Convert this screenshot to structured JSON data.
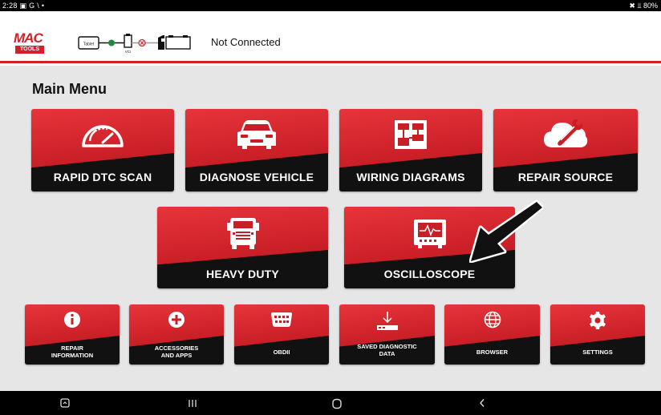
{
  "status_bar": {
    "time": "2:28",
    "left_icons": "▣ G \\ •",
    "right": "✖ ⫫ 80%"
  },
  "header": {
    "logo_top": "MAC",
    "logo_bottom": "TOOLS",
    "connection_status": "Not Connected",
    "diagram_tablet": "Tablet",
    "diagram_vci": "VCI"
  },
  "main": {
    "title": "Main Menu",
    "tiles_row1": [
      "RAPID DTC SCAN",
      "DIAGNOSE VEHICLE",
      "WIRING DIAGRAMS",
      "REPAIR SOURCE"
    ],
    "tiles_row2": [
      "HEAVY DUTY",
      "OSCILLOSCOPE"
    ],
    "tiles_row3": [
      [
        "REPAIR",
        "INFORMATION"
      ],
      [
        "ACCESSORIES",
        "AND APPS"
      ],
      [
        "OBDII",
        ""
      ],
      [
        "SAVED DIAGNOSTIC",
        "DATA"
      ],
      [
        "BROWSER",
        ""
      ],
      [
        "SETTINGS",
        ""
      ]
    ]
  },
  "colors": {
    "accent": "#d3202a",
    "tile_dark": "#111111",
    "background": "#e6e6e6"
  },
  "icons": {
    "rapid_dtc_scan": "speedometer-icon",
    "diagnose_vehicle": "car-icon",
    "wiring_diagrams": "wiring-diagram-icon",
    "repair_source": "cloud-wrench-icon",
    "heavy_duty": "truck-icon",
    "oscilloscope": "oscilloscope-icon",
    "repair_information": "info-icon",
    "accessories_and_apps": "plus-circle-icon",
    "obdii": "obd-connector-icon",
    "saved_diagnostic_data": "download-icon",
    "browser": "globe-icon",
    "settings": "gear-icon"
  }
}
